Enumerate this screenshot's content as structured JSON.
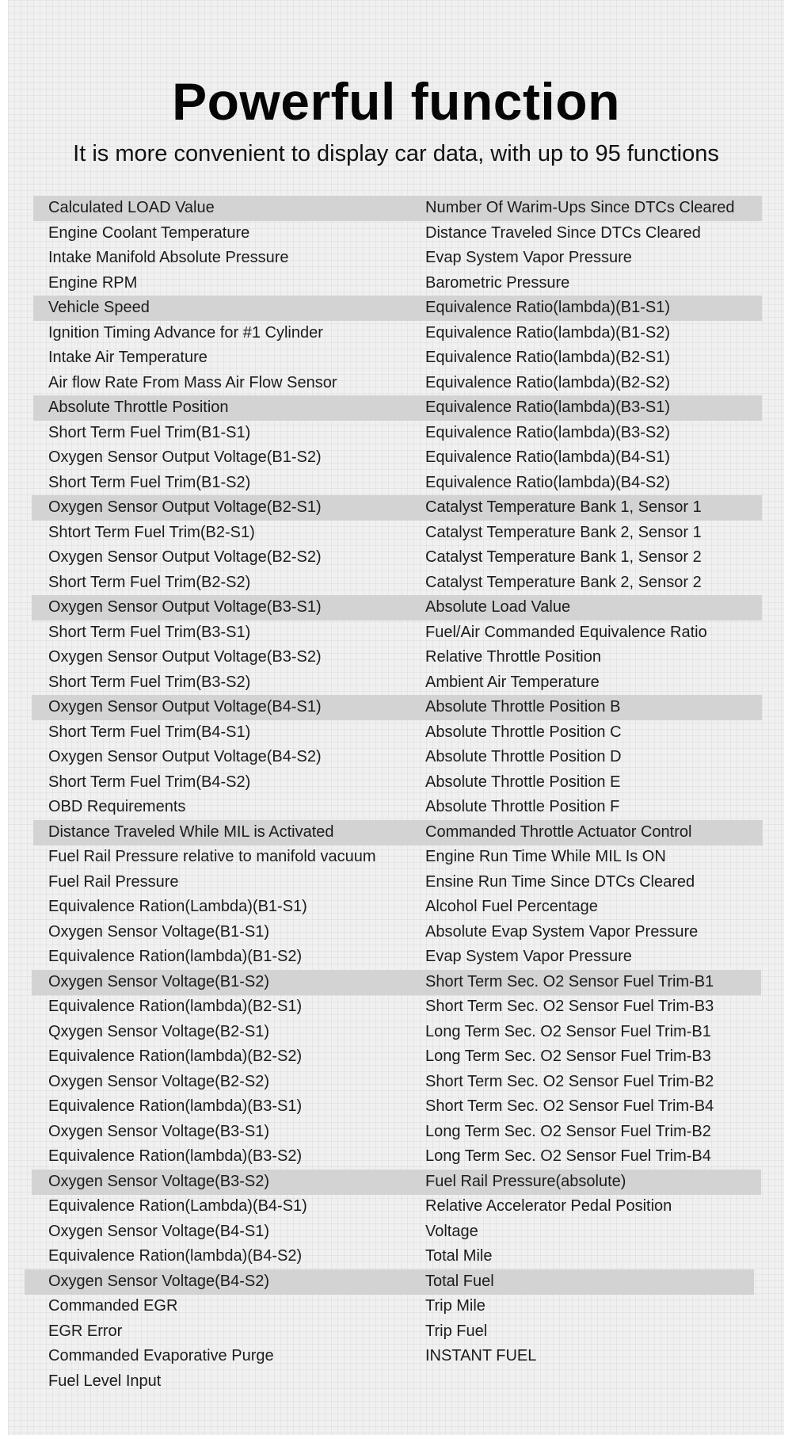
{
  "header": {
    "title": "Powerful function",
    "subtitle": "It is more convenient to display car data, with up to 95 functions"
  },
  "functions": {
    "left": [
      "Calculated LOAD Value",
      "Engine Coolant Temperature",
      "Intake Manifold Absolute Pressure",
      "Engine RPM",
      "Vehicle Speed",
      "Ignition Timing Advance for #1 Cylinder",
      "Intake Air Temperature",
      "Air flow Rate From Mass Air Flow Sensor",
      "Absolute Throttle Position",
      "Short Term Fuel Trim(B1-S1)",
      "Oxygen Sensor Output Voltage(B1-S2)",
      "Short Term Fuel Trim(B1-S2)",
      "Oxygen Sensor Output Voltage(B2-S1)",
      "Shtort Term Fuel Trim(B2-S1)",
      "Oxygen Sensor Output Voltage(B2-S2)",
      "Short Term Fuel Trim(B2-S2)",
      "Oxygen Sensor Output Voltage(B3-S1)",
      "Short Term Fuel Trim(B3-S1)",
      "Oxygen Sensor Output Voltage(B3-S2)",
      "Short Term Fuel Trim(B3-S2)",
      "Oxygen Sensor Output Voltage(B4-S1)",
      "Short Term Fuel Trim(B4-S1)",
      "Oxygen Sensor Output Voltage(B4-S2)",
      "Short Term Fuel Trim(B4-S2)",
      "OBD Requirements",
      "Distance Traveled While MIL is Activated",
      "Fuel Rail Pressure relative to manifold vacuum",
      "Fuel Rail Pressure",
      "Equivalence Ration(Lambda)(B1-S1)",
      "Oxygen Sensor Voltage(B1-S1)",
      "Equivalence Ration(lambda)(B1-S2)",
      "Oxygen Sensor Voltage(B1-S2)",
      "Equivalence Ration(lambda)(B2-S1)",
      "Qxygen Sensor Voltage(B2-S1)",
      "Equivalence Ration(lambda)(B2-S2)",
      "Oxygen Sensor Voltage(B2-S2)",
      "Equivalence Ration(lambda)(B3-S1)",
      "Oxygen Sensor Voltage(B3-S1)",
      "Equivalence Ration(lambda)(B3-S2)",
      "Oxygen Sensor Voltage(B3-S2)",
      "Equivalence Ration(Lambda)(B4-S1)",
      "Oxygen Sensor Voltage(B4-S1)",
      "Equivalence Ration(lambda)(B4-S2)",
      "Oxygen Sensor Voltage(B4-S2)",
      "Commanded EGR",
      "EGR Error",
      "Commanded Evaporative Purge",
      "Fuel Level Input"
    ],
    "right": [
      "Number Of Warim-Ups Since DTCs Cleared",
      "Distance Traveled Since DTCs Cleared",
      "Evap System Vapor Pressure",
      "Barometric Pressure",
      "Equivalence Ratio(lambda)(B1-S1)",
      "Equivalence Ratio(lambda)(B1-S2)",
      "Equivalence Ratio(lambda)(B2-S1)",
      "Equivalence Ratio(lambda)(B2-S2)",
      "Equivalence Ratio(lambda)(B3-S1)",
      "Equivalence Ratio(lambda)(B3-S2)",
      "Equivalence Ratio(lambda)(B4-S1)",
      "Equivalence Ratio(lambda)(B4-S2)",
      "Catalyst Temperature Bank 1, Sensor 1",
      "Catalyst Temperature Bank 2, Sensor 1",
      "Catalyst Temperature Bank 1, Sensor 2",
      "Catalyst Temperature Bank 2, Sensor 2",
      "Absolute Load Value",
      "Fuel/Air Commanded Equivalence Ratio",
      "Relative Throttle Position",
      "Ambient Air Temperature",
      "Absolute Throttle Position B",
      "Absolute Throttle Position C",
      "Absolute Throttle Position D",
      "Absolute Throttle Position E",
      "Absolute Throttle Position F",
      "Commanded Throttle Actuator Control",
      "Engine Run Time While MIL Is ON",
      "Ensine Run Time Since DTCs Cleared",
      "Alcohol Fuel Percentage",
      "Absolute Evap System Vapor Pressure",
      "Evap System Vapor Pressure",
      "Short Term Sec. O2 Sensor Fuel Trim-B1",
      "Short Term Sec. O2 Sensor Fuel Trim-B3",
      "Long Term Sec. O2 Sensor Fuel Trim-B1",
      "Long Term Sec. O2 Sensor Fuel Trim-B3",
      "Short Term Sec. O2 Sensor Fuel Trim-B2",
      "Short Term Sec. O2 Sensor Fuel Trim-B4",
      "Long Term Sec. O2 Sensor Fuel Trim-B2",
      "Long Term Sec. O2 Sensor Fuel Trim-B4",
      "Fuel Rail Pressure(absolute)",
      "Relative Accelerator Pedal Position",
      "Voltage",
      "Total Mile",
      "Total Fuel",
      "Trip Mile",
      "Trip Fuel",
      "INSTANT FUEL"
    ],
    "highlighted_rows": [
      0,
      4,
      8,
      12,
      16,
      20,
      25,
      31,
      39,
      43
    ]
  },
  "colors": {
    "highlight_band": "#d3d3d3",
    "background": "#f0f0f0",
    "text": "#1c1c1c"
  }
}
